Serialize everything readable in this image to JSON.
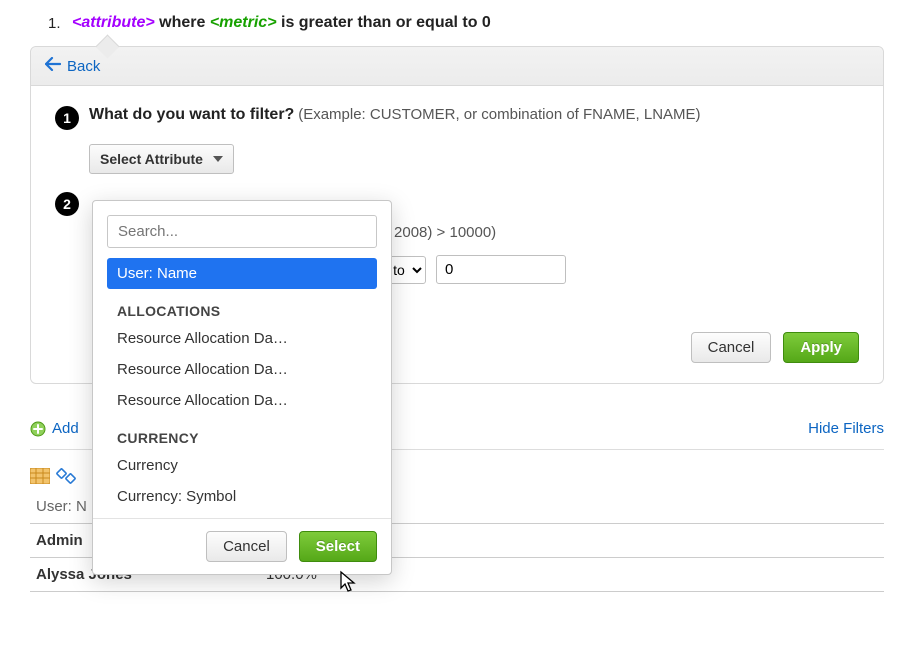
{
  "rule": {
    "index": "1.",
    "attr_token": "<attribute>",
    "where": " where ",
    "metric_token": "<metric>",
    "rest": " is greater than or equal to 0"
  },
  "panel": {
    "back_label": "Back",
    "step1_title": "What do you want to filter?",
    "step1_hint": " (Example: CUSTOMER, or combination of FNAME, LNAME)",
    "select_attribute_label": "Select Attribute",
    "step2_hint_fragment": "ES (in 2008) > 10000)",
    "operator_selected": "equal to",
    "value": "0",
    "cancel_label": "Cancel",
    "apply_label": "Apply"
  },
  "popover": {
    "search_placeholder": "Search...",
    "selected_item": "User: Name",
    "group1_label": "ALLOCATIONS",
    "group1_items": [
      "Resource Allocation Da…",
      "Resource Allocation Da…",
      "Resource Allocation Da…"
    ],
    "group2_label": "CURRENCY",
    "group2_items": [
      "Currency",
      "Currency: Symbol"
    ],
    "cancel_label": "Cancel",
    "select_label": "Select"
  },
  "below": {
    "add_label": "Add",
    "hide_filters_label": "Hide Filters"
  },
  "table": {
    "col1_header": "User: N",
    "rows": [
      {
        "name": "Admin",
        "value": ""
      },
      {
        "name": "Alyssa Jones",
        "value": "100.0%"
      }
    ]
  }
}
